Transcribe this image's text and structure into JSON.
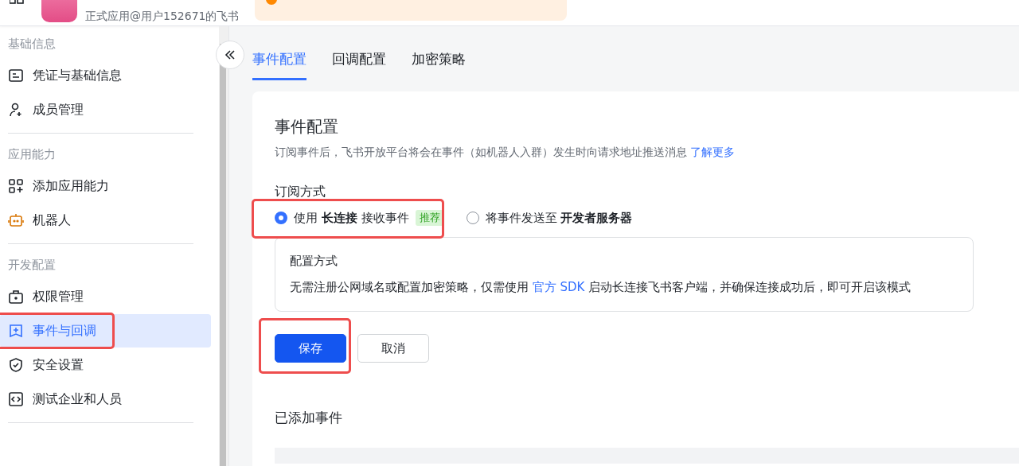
{
  "header": {
    "app_subtitle": "正式应用@用户152671的飞书"
  },
  "sidebar": {
    "sections": [
      {
        "title": "基础信息",
        "items": [
          {
            "label": "凭证与基础信息",
            "kind": "card",
            "selected": false
          },
          {
            "label": "成员管理",
            "kind": "member",
            "selected": false
          }
        ]
      },
      {
        "title": "应用能力",
        "items": [
          {
            "label": "添加应用能力",
            "kind": "apps",
            "selected": false
          },
          {
            "label": "机器人",
            "kind": "robot",
            "selected": false
          }
        ]
      },
      {
        "title": "开发配置",
        "items": [
          {
            "label": "权限管理",
            "kind": "lock",
            "selected": false
          },
          {
            "label": "事件与回调",
            "kind": "event",
            "selected": true
          },
          {
            "label": "安全设置",
            "kind": "shield",
            "selected": false
          },
          {
            "label": "测试企业和人员",
            "kind": "code",
            "selected": false
          }
        ]
      }
    ]
  },
  "tabs": [
    {
      "label": "事件配置",
      "selected": true
    },
    {
      "label": "回调配置",
      "selected": false
    },
    {
      "label": "加密策略",
      "selected": false
    }
  ],
  "card": {
    "title": "事件配置",
    "description": "订阅事件后，飞书开放平台将会在事件（如机器人入群）发生时向请求地址推送消息",
    "description_link": "了解更多",
    "subscription": {
      "label": "订阅方式",
      "options": [
        {
          "text": "使用 **长连接** 接收事件",
          "badge": "推荐",
          "selected": true
        },
        {
          "text": "将事件发送至 **开发者服务器**",
          "selected": false
        }
      ]
    },
    "info": {
      "title": "配置方式",
      "text_before": "无需注册公网域名或配置加密策略，仅需使用",
      "link": "官方 SDK",
      "text_after": "启动长连接飞书客户端，并确保连接成功后，即可开启该模式"
    },
    "buttons": [
      {
        "label": "保存",
        "kind": "primary"
      },
      {
        "label": "取消",
        "kind": "secondary"
      }
    ],
    "added_events_title": "已添加事件"
  }
}
